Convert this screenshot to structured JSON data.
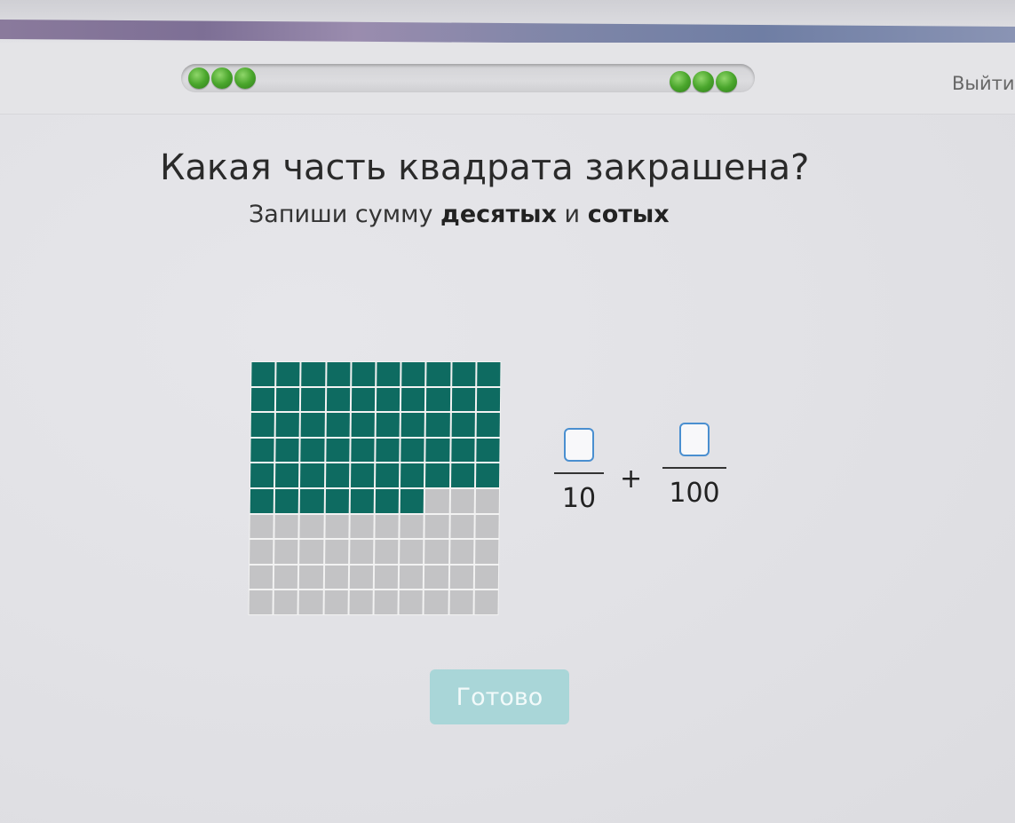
{
  "header": {
    "exit_label": "Выйти"
  },
  "task": {
    "title": "Какая часть квадрата закрашена?",
    "subtitle_prefix": "Запиши сумму ",
    "subtitle_bold_1": "десятых",
    "subtitle_middle": " и ",
    "subtitle_bold_2": "сотых"
  },
  "grid": {
    "rows": 10,
    "cols": 10,
    "filled_count": 57,
    "filled_color": "#0e6b61",
    "empty_color": "#c3c3c5"
  },
  "answer": {
    "tenths_value": "",
    "tenths_denominator": "10",
    "plus_sign": "+",
    "hundredths_value": "",
    "hundredths_denominator": "100"
  },
  "actions": {
    "done_label": "Готово"
  },
  "colors": {
    "accent_input_border": "#4a8fd0",
    "done_button_disabled": "#a9d6d8",
    "progress_dot": "#4aa62c"
  }
}
